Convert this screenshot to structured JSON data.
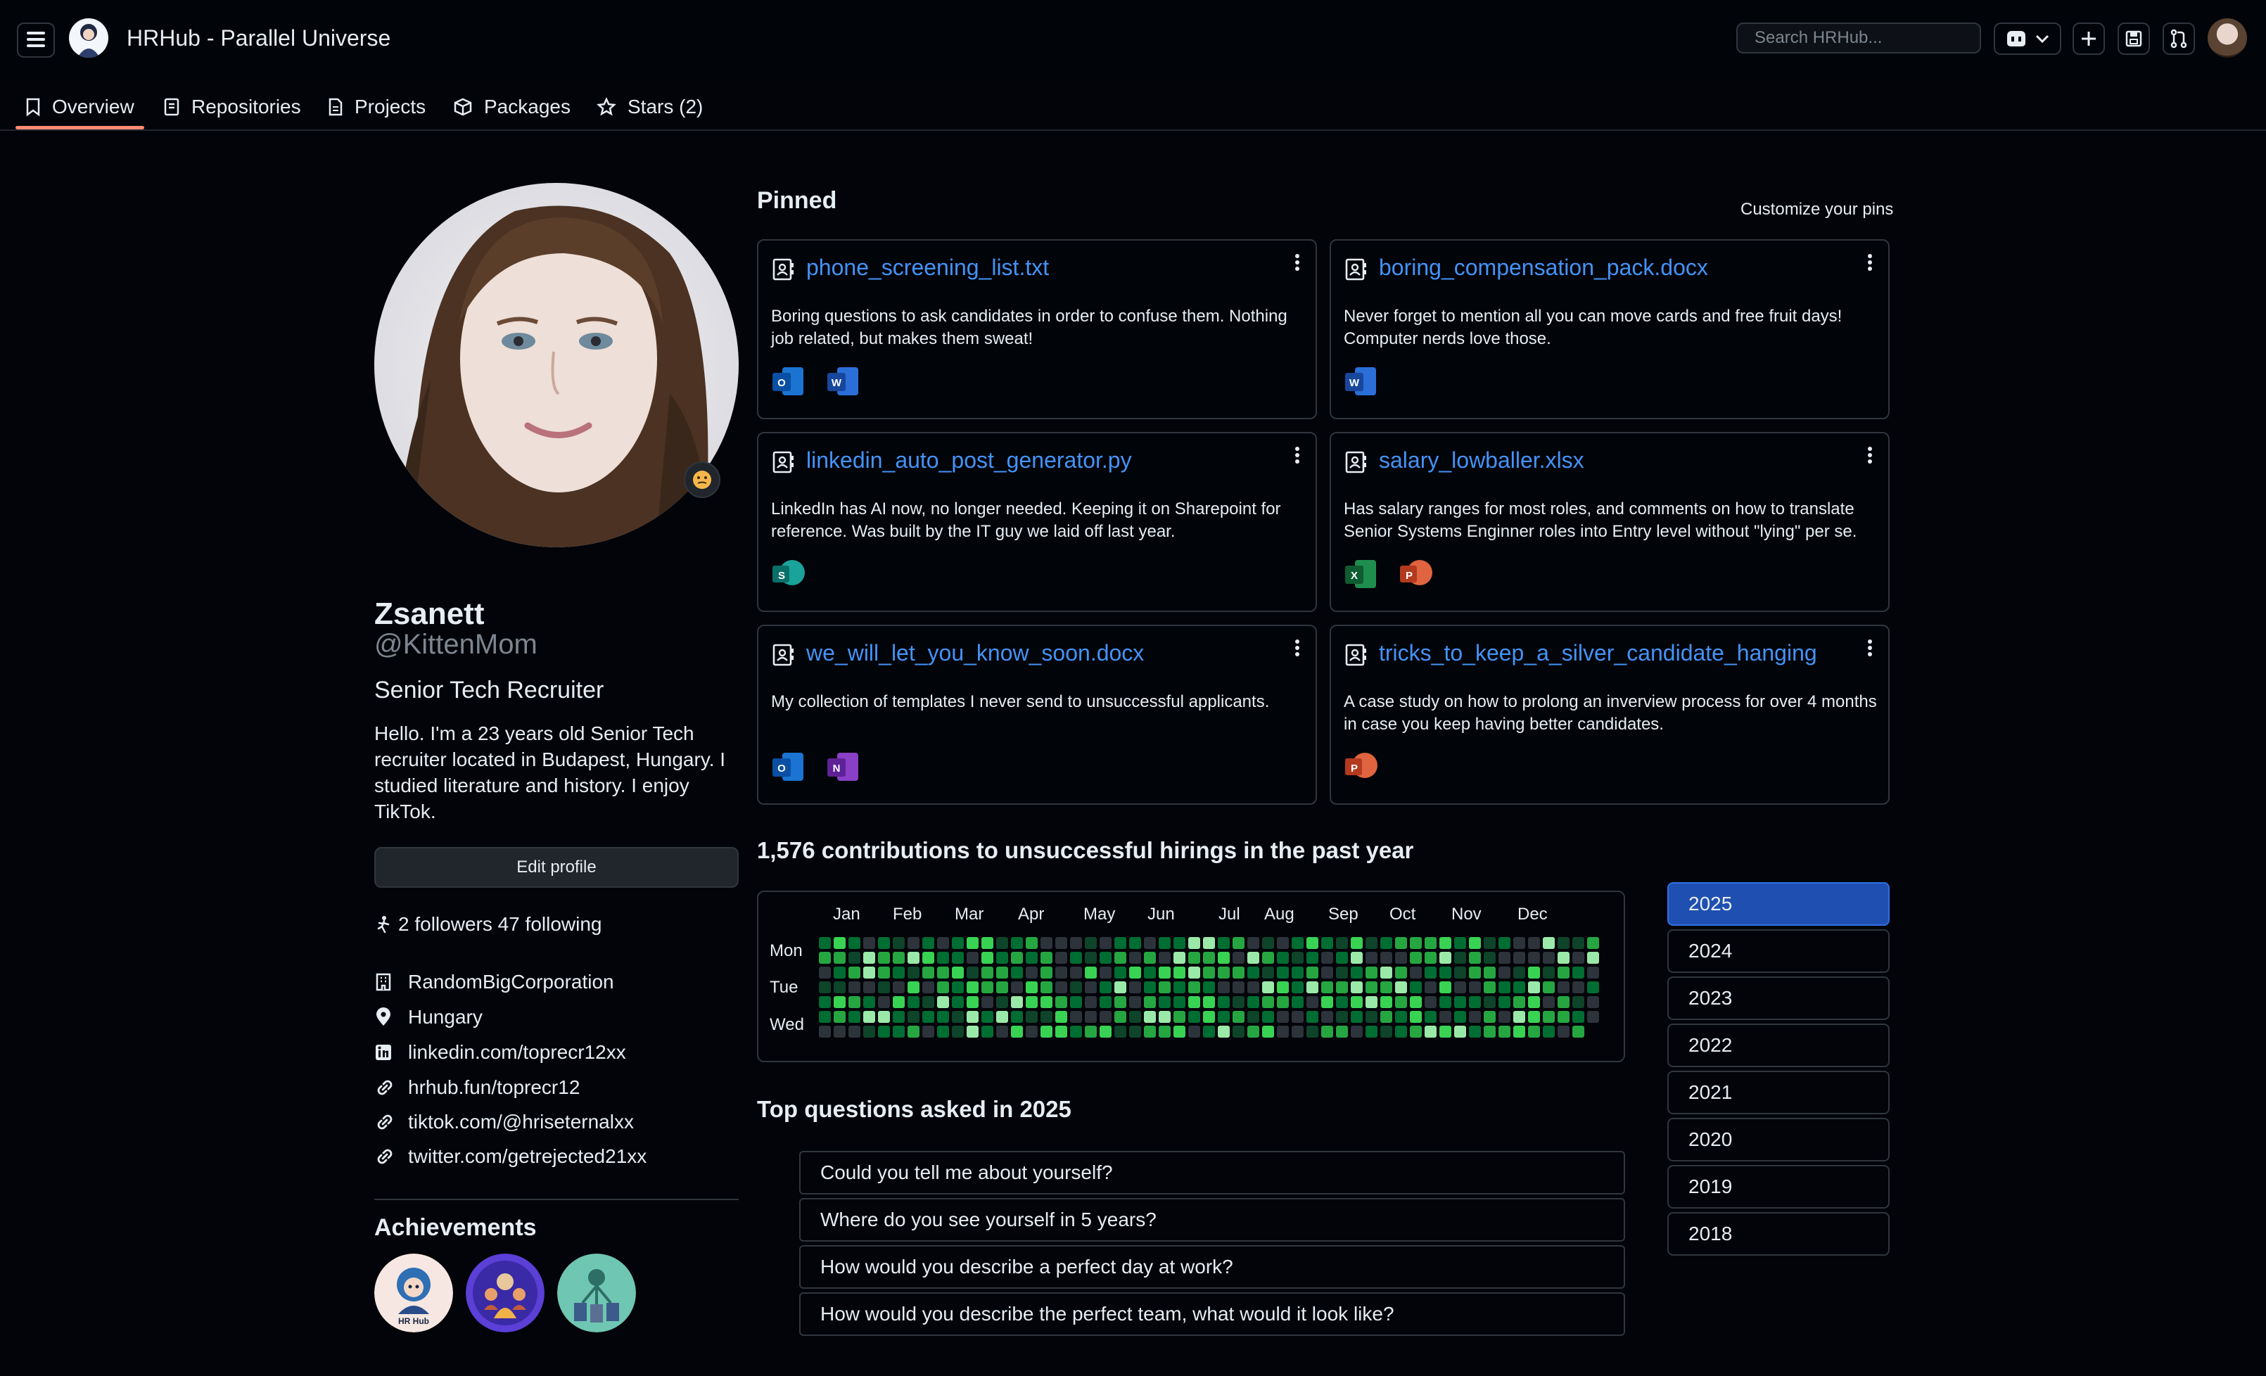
{
  "header": {
    "title": "HRHub - Parallel Universe",
    "search_placeholder": "Search HRHub...",
    "icons": [
      "menu-icon",
      "copilot-icon",
      "chevron-down-icon",
      "plus-icon",
      "save-icon",
      "pull-request-icon"
    ]
  },
  "tabs": [
    {
      "label": "Overview",
      "icon": "book-icon",
      "active": true
    },
    {
      "label": "Repositories",
      "icon": "repo-icon"
    },
    {
      "label": "Projects",
      "icon": "project-icon"
    },
    {
      "label": "Packages",
      "icon": "package-icon"
    },
    {
      "label": "Stars (2)",
      "icon": "star-icon"
    }
  ],
  "profile": {
    "name": "Zsanett",
    "username": "@KittenMom",
    "role": "Senior Tech Recruiter",
    "bio": "Hello. I'm a 23 years old Senior Tech recruiter located in Budapest, Hungary. I studied literature and history. I enjoy TikTok.",
    "edit_label": "Edit profile",
    "followers": "2 followers 47 following",
    "company": "RandomBigCorporation",
    "location": "Hungary",
    "linkedin": "linkedin.com/toprecr12xx",
    "link1": "hrhub.fun/toprecr12",
    "link2": "tiktok.com/@hriseternalxx",
    "link3": "twitter.com/getrejected21xx",
    "achievements_title": "Achievements",
    "badge1_text": "HR Hub"
  },
  "pinned": {
    "title": "Pinned",
    "customize": "Customize your pins",
    "cards": [
      {
        "name": "phone_screening_list.txt",
        "desc": "Boring questions to ask candidates in order to confuse them. Nothing job related, but makes them sweat!",
        "apps": [
          "O",
          "W"
        ]
      },
      {
        "name": "boring_compensation_pack.docx",
        "desc": "Never forget to mention all you can move cards and free fruit days! Computer nerds love those.",
        "apps": [
          "W"
        ]
      },
      {
        "name": "linkedin_auto_post_generator.py",
        "desc": "LinkedIn has AI now, no longer needed. Keeping it on Sharepoint for reference. Was built by the IT guy we laid off last year.",
        "apps": [
          "S"
        ]
      },
      {
        "name": "salary_lowballer.xlsx",
        "desc": "Has salary ranges for most roles, and comments on how to translate Senior Systems Enginner roles into Entry level without \"lying\" per se.",
        "apps": [
          "X",
          "P"
        ]
      },
      {
        "name": "we_will_let_you_know_soon.docx",
        "desc": "My collection of templates I never send to unsuccessful applicants.",
        "apps": [
          "O",
          "N"
        ]
      },
      {
        "name": "tricks_to_keep_a_silver_candidate_hanging",
        "desc": "A case study on how to prolong an inverview process for over 4 months in case you keep having better candidates.",
        "apps": [
          "P"
        ]
      }
    ]
  },
  "contributions": {
    "title": "1,576 contributions to unsuccessful hirings in the past year",
    "months": [
      "Jan",
      "Feb",
      "Mar",
      "Apr",
      "May",
      "Jun",
      "Jul",
      "Aug",
      "Sep",
      "Oct",
      "Nov",
      "Dec"
    ],
    "days": [
      "Mon",
      "Tue",
      "Wed"
    ],
    "palette": [
      "#2d333b",
      "#0e4429",
      "#006d32",
      "#26a641",
      "#39d353",
      "#9be9a8"
    ]
  },
  "years": [
    "2025",
    "2024",
    "2023",
    "2022",
    "2021",
    "2020",
    "2019",
    "2018"
  ],
  "questions": {
    "title": "Top questions asked in 2025",
    "items": [
      "Could you tell me about yourself?",
      "Where do you see yourself in 5 years?",
      "How would you describe a perfect day at work?",
      "How would you describe the perfect team, what would it look like?"
    ]
  }
}
